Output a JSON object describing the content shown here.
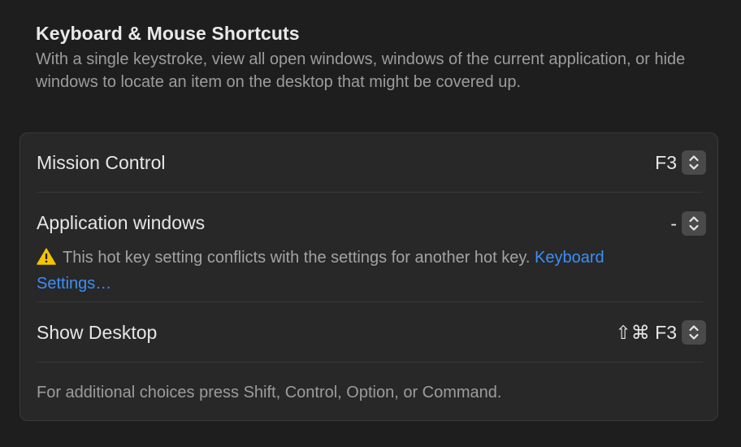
{
  "section": {
    "title": "Keyboard & Mouse Shortcuts",
    "description": "With a single keystroke, view all open windows, windows of the current application, or hide windows to locate an item on the desktop that might be covered up."
  },
  "shortcuts": [
    {
      "label": "Mission Control",
      "value": "F3"
    },
    {
      "label": "Application windows",
      "value": "-",
      "warning": "This hot key setting conflicts with the settings for another hot key.",
      "warning_link": "Keyboard Settings…"
    },
    {
      "label": "Show Desktop",
      "value": "⇧⌘ F3"
    }
  ],
  "footnote": "For additional choices press Shift, Control, Option, or Command.",
  "icons": {
    "stepper": "chevron-up-down-icon",
    "warning": "warning-triangle-icon"
  },
  "colors": {
    "background": "#1e1e1e",
    "group_background": "#282828",
    "link": "#3b8ff7",
    "warning": "#f5c400"
  }
}
